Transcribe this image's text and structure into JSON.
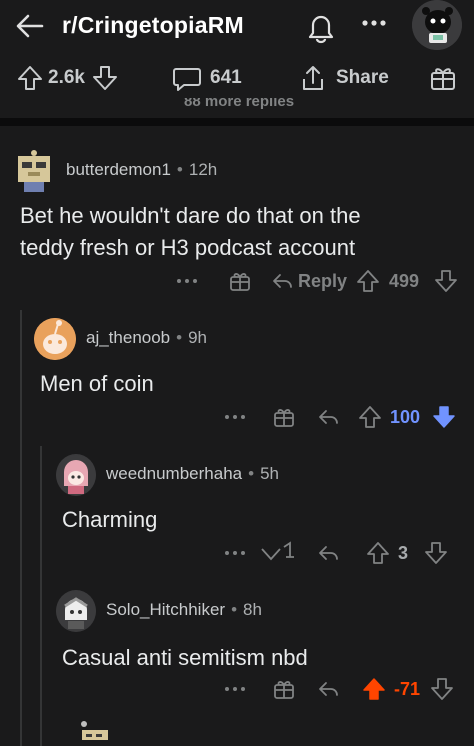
{
  "header": {
    "subreddit": "r/CringetopiaRM",
    "icons": [
      "back-arrow-icon",
      "bell-icon",
      "more-icon",
      "avatar"
    ]
  },
  "post_actions": {
    "score": "2.6k",
    "comments": "641",
    "share_label": "Share"
  },
  "more_replies": "88 more replies",
  "comments": [
    {
      "username": "butterdemon1",
      "age": "12h",
      "body_lines": [
        "Bet he wouldn't dare do that on the",
        "teddy fresh or H3 podcast account"
      ],
      "reply_label": "Reply",
      "score": "499",
      "vote_state": "none"
    },
    {
      "username": "aj_thenoob",
      "age": "9h",
      "body_lines": [
        "Men of coin"
      ],
      "score": "100",
      "vote_state": "down"
    },
    {
      "username": "weednumberhaha",
      "age": "5h",
      "body_lines": [
        "Charming"
      ],
      "score": "3",
      "vote_state": "none"
    },
    {
      "username": "Solo_Hitchhiker",
      "age": "8h",
      "body_lines": [
        "Casual anti semitism nbd"
      ],
      "score": "-71",
      "vote_state": "up"
    }
  ],
  "colors": {
    "background": "#1a1a1b",
    "upvote": "#ff4500",
    "downvote": "#7193ff",
    "text": "#d7dadc",
    "muted": "#818384"
  }
}
